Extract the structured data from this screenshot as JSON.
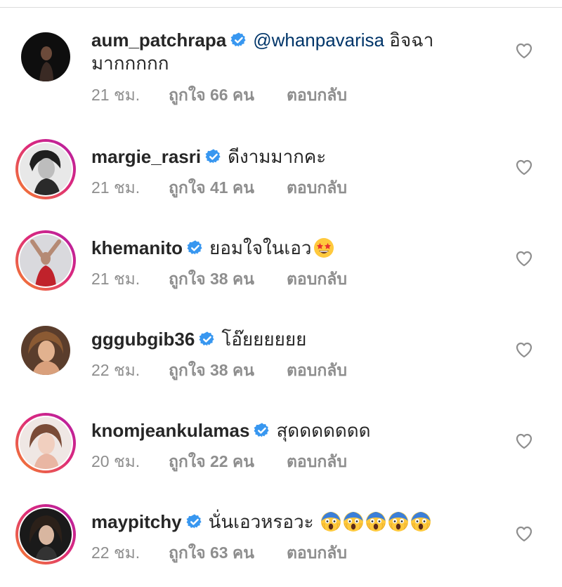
{
  "comments": [
    {
      "username": "aum_patchrapa",
      "mention": "@whanpavarisa",
      "text": "อิจฉา",
      "text_line2": "มากกกกก",
      "time": "21 ชม.",
      "likes": "ถูกใจ 66 คน",
      "reply": "ตอบกลับ",
      "verified_icon": "verified-badge-icon",
      "story_ring": false
    },
    {
      "username": "margie_rasri",
      "text": "ดีงามมากคะ",
      "time": "21 ชม.",
      "likes": "ถูกใจ 41 คน",
      "reply": "ตอบกลับ",
      "verified_icon": "verified-badge-icon",
      "story_ring": true
    },
    {
      "username": "khemanito",
      "text": "ยอมใจในเอว",
      "emoji": "star-struck-emoji",
      "time": "21 ชม.",
      "likes": "ถูกใจ 38 คน",
      "reply": "ตอบกลับ",
      "verified_icon": "verified-badge-icon",
      "story_ring": true
    },
    {
      "username": "gggubgib36",
      "text": "โอ๊ยยยยยย",
      "time": "22 ชม.",
      "likes": "ถูกใจ 38 คน",
      "reply": "ตอบกลับ",
      "verified_icon": "verified-badge-icon",
      "story_ring": false
    },
    {
      "username": "knomjeankulamas",
      "text": "สุดดดดดดด",
      "time": "20 ชม.",
      "likes": "ถูกใจ 22 คน",
      "reply": "ตอบกลับ",
      "verified_icon": "verified-badge-icon",
      "story_ring": true
    },
    {
      "username": "maypitchy",
      "text": "นั่นเอวหรอวะ",
      "emoji": "screaming-in-fear-emoji",
      "emoji_count": 5,
      "time": "22 ชม.",
      "likes": "ถูกใจ 63 คน",
      "reply": "ตอบกลับ",
      "verified_icon": "verified-badge-icon",
      "story_ring": true
    }
  ],
  "icons": {
    "like": "heart-outline-icon",
    "verified": "verified-badge-icon"
  },
  "colors": {
    "username": "#262626",
    "mention": "#003569",
    "meta": "#8e8e8e",
    "verified": "#3897f0",
    "story_ring_start": "#f58529",
    "story_ring_end": "#b01ea8"
  }
}
